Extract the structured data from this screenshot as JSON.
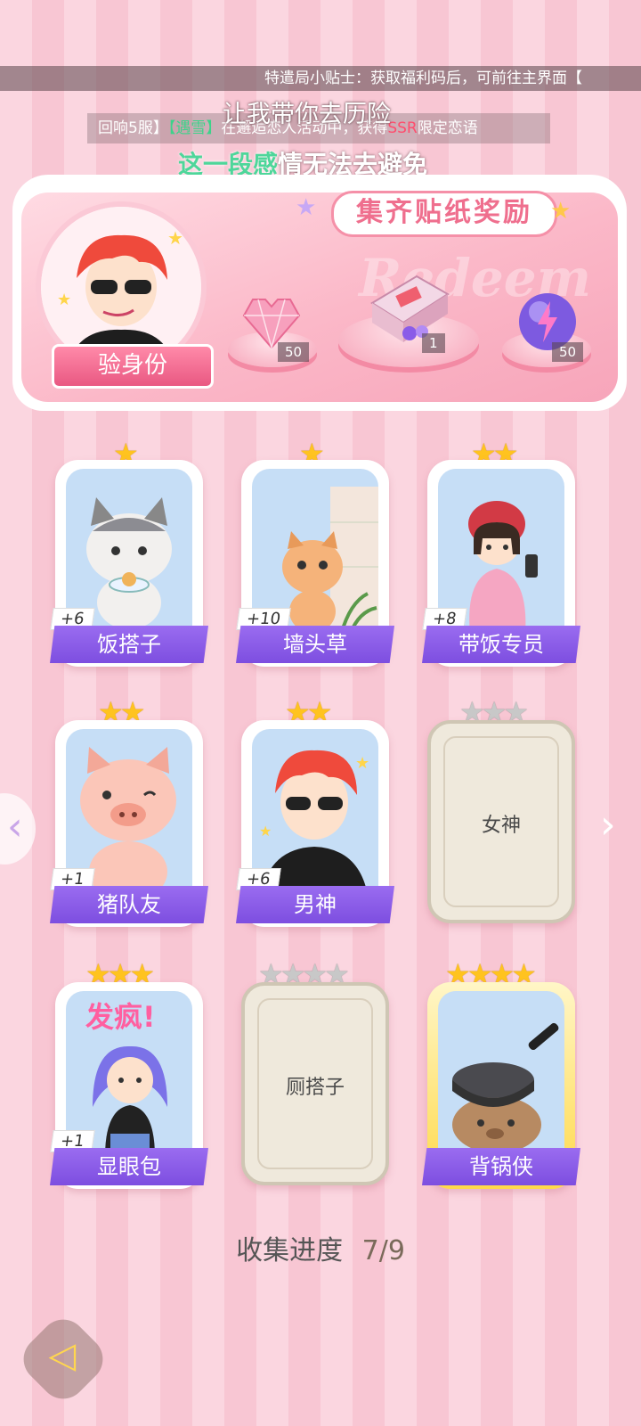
{
  "tip": "特遣局小贴士：获取福利码后，可前往主界面【",
  "lyric_line_1": "让我带你去历险",
  "lyric_line_2_highlight": "这一段感",
  "lyric_line_2_rest": "情无法去避免",
  "broadcast": {
    "part1": "回响5服】",
    "part2": "【遇雪】",
    "part3": "在邂逅恋人活动中，获得",
    "part4": "SSR",
    "part5": "限定恋语"
  },
  "banner": {
    "title": "集齐贴纸奖励",
    "bg_word": "Redeem",
    "verify_label": "验身份",
    "rewards": [
      {
        "icon": "pink-heart-gem-icon",
        "qty": "50"
      },
      {
        "icon": "gift-box-icon",
        "qty": "1"
      },
      {
        "icon": "lightning-orb-icon",
        "qty": "50"
      }
    ]
  },
  "cards": [
    {
      "name": "饭搭子",
      "count": "+6",
      "stars": 1,
      "locked": false
    },
    {
      "name": "墙头草",
      "count": "+10",
      "stars": 1,
      "locked": false
    },
    {
      "name": "带饭专员",
      "count": "+8",
      "stars": 2,
      "locked": false
    },
    {
      "name": "猪队友",
      "count": "+1",
      "stars": 2,
      "locked": false
    },
    {
      "name": "男神",
      "count": "+6",
      "stars": 2,
      "locked": false
    },
    {
      "name": "女神",
      "count": "",
      "stars": 3,
      "locked": true
    },
    {
      "name": "显眼包",
      "count": "+1",
      "stars": 3,
      "locked": false
    },
    {
      "name": "厕搭子",
      "count": "",
      "stars": 4,
      "locked": true
    },
    {
      "name": "背锅侠",
      "count": "",
      "stars": 4,
      "locked": false
    }
  ],
  "progress_label": "收集进度",
  "progress_value": "7/9",
  "colors": {
    "accent_purple": "#8a5ce8",
    "pink": "#ef6f8e",
    "star_gold": "#ffc31f"
  }
}
